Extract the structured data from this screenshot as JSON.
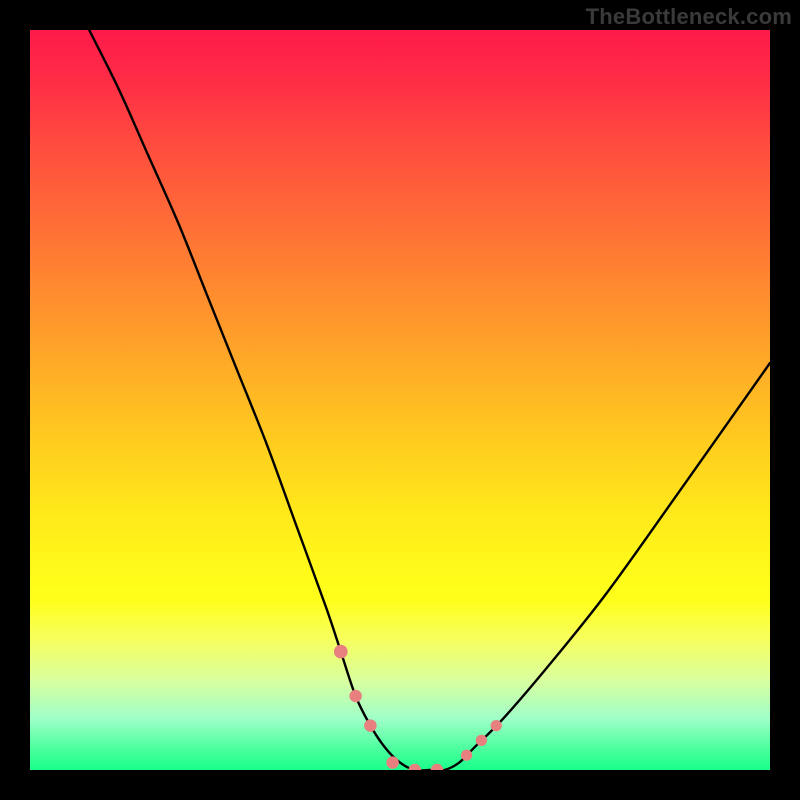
{
  "watermark": {
    "text": "TheBottleneck.com"
  },
  "chart_data": {
    "type": "line",
    "title": "",
    "xlabel": "",
    "ylabel": "",
    "xlim": [
      0,
      100
    ],
    "ylim": [
      0,
      100
    ],
    "grid": false,
    "legend": false,
    "background_gradient": {
      "direction": "vertical",
      "stops": [
        {
          "pos": 0,
          "color": "#ff1a4b"
        },
        {
          "pos": 25,
          "color": "#ff6a37"
        },
        {
          "pos": 55,
          "color": "#ffca1f"
        },
        {
          "pos": 77,
          "color": "#ffff1b"
        },
        {
          "pos": 100,
          "color": "#1aff8a"
        }
      ]
    },
    "series": [
      {
        "name": "bottleneck-curve",
        "color": "#000000",
        "x": [
          8,
          12,
          16,
          20,
          24,
          28,
          32,
          36,
          40,
          42,
          44,
          46,
          48,
          50,
          52,
          54,
          56,
          58,
          60,
          64,
          70,
          78,
          88,
          100
        ],
        "y": [
          100,
          92,
          83,
          74,
          64,
          54,
          44,
          33,
          22,
          16,
          10,
          6,
          3,
          1,
          0,
          0,
          0,
          1,
          3,
          7,
          14,
          24,
          38,
          55
        ]
      }
    ],
    "markers": [
      {
        "name": "dot-left-1",
        "x": 42,
        "y": 16,
        "color": "#e98080",
        "size": 11
      },
      {
        "name": "dot-left-2",
        "x": 44,
        "y": 10,
        "color": "#e98080",
        "size": 10
      },
      {
        "name": "dot-left-3",
        "x": 46,
        "y": 6,
        "color": "#e98080",
        "size": 10
      },
      {
        "name": "dot-bottom-1",
        "x": 49,
        "y": 1,
        "color": "#e98080",
        "size": 10
      },
      {
        "name": "dot-bottom-2",
        "x": 52,
        "y": 0,
        "color": "#e98080",
        "size": 10
      },
      {
        "name": "dot-bottom-3",
        "x": 55,
        "y": 0,
        "color": "#e98080",
        "size": 10
      },
      {
        "name": "dot-right-1",
        "x": 59,
        "y": 2,
        "color": "#e98080",
        "size": 9
      },
      {
        "name": "dot-right-2",
        "x": 61,
        "y": 4,
        "color": "#e98080",
        "size": 9
      },
      {
        "name": "dot-right-3",
        "x": 63,
        "y": 6,
        "color": "#e98080",
        "size": 9
      }
    ]
  }
}
